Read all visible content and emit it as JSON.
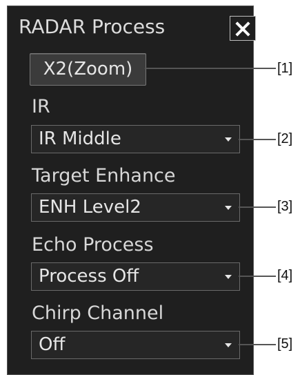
{
  "window": {
    "title": "RADAR Process",
    "close_icon": "close-icon"
  },
  "controls": {
    "zoom_button": "X2(Zoom)",
    "ir": {
      "label": "IR",
      "value": "IR Middle"
    },
    "target_enhance": {
      "label": "Target Enhance",
      "value": "ENH Level2"
    },
    "echo_process": {
      "label": "Echo Process",
      "value": "Process Off"
    },
    "chirp_channel": {
      "label": "Chirp Channel",
      "value": "Off"
    }
  },
  "callouts": [
    "[1]",
    "[2]",
    "[3]",
    "[4]",
    "[5]"
  ]
}
